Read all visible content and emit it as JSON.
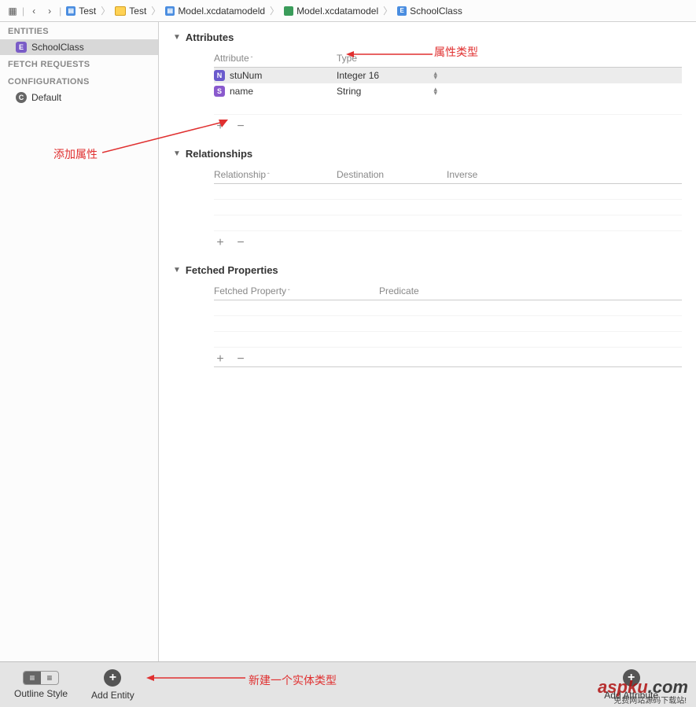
{
  "breadcrumb": {
    "items": [
      "Test",
      "Test",
      "Model.xcdatamodeld",
      "Model.xcdatamodel",
      "SchoolClass"
    ]
  },
  "sidebar": {
    "entities_h": "ENTITIES",
    "entity": "SchoolClass",
    "fetch_h": "FETCH REQUESTS",
    "config_h": "CONFIGURATIONS",
    "config_item": "Default"
  },
  "sections": {
    "attributes": {
      "title": "Attributes",
      "col_attr": "Attribute",
      "col_type": "Type",
      "rows": [
        {
          "name": "stuNum",
          "type": "Integer 16",
          "icon": "N"
        },
        {
          "name": "name",
          "type": "String",
          "icon": "S"
        }
      ]
    },
    "relationships": {
      "title": "Relationships",
      "col1": "Relationship",
      "col2": "Destination",
      "col3": "Inverse"
    },
    "fetched": {
      "title": "Fetched Properties",
      "col1": "Fetched Property",
      "col2": "Predicate"
    }
  },
  "bottom": {
    "outline": "Outline Style",
    "add_entity": "Add Entity",
    "add_attr": "Add Attribute"
  },
  "annotations": {
    "attr_type": "属性类型",
    "add_attr": "添加属性",
    "new_entity": "新建一个实体类型"
  },
  "watermark": {
    "brand": "aspku",
    "suffix": ".com",
    "sub": "免费网站源码下载站!"
  }
}
